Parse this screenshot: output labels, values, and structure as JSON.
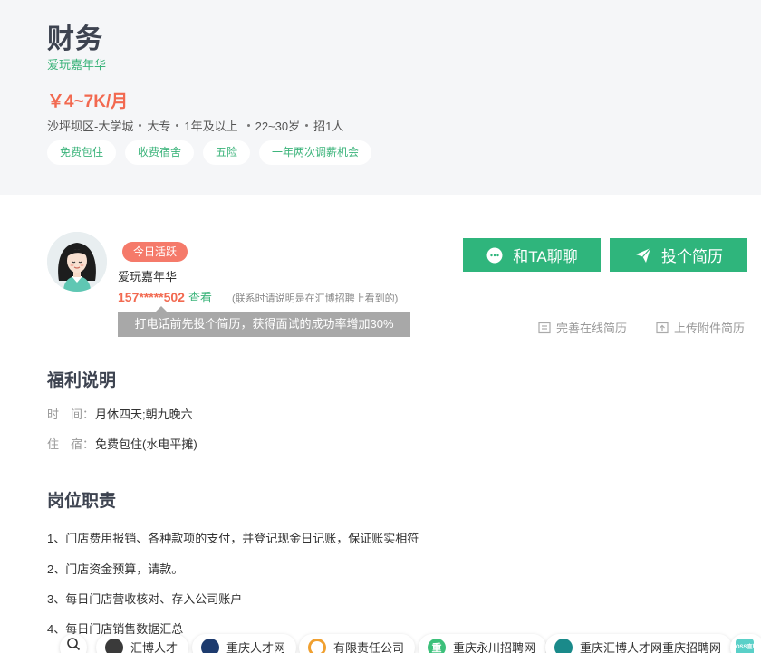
{
  "job": {
    "title": "财务",
    "company": "爱玩嘉年华",
    "salary": "￥4~7K/月",
    "meta": [
      "沙坪坝区-大学城",
      "大专",
      "1年及以上",
      "22~30岁",
      "招1人"
    ],
    "tags": [
      "免费包住",
      "收费宿舍",
      "五险",
      "一年两次调薪机会"
    ]
  },
  "recruiter": {
    "badge": "今日活跃",
    "name": "爱玩嘉年华",
    "phone": "157*****502",
    "view_label": "查看",
    "phone_note": "(联系时请说明是在汇博招聘上看到的)",
    "tooltip": "打电话前先投个简历，获得面试的成功率增加30%"
  },
  "actions": {
    "chat_label": "和TA聊聊",
    "apply_label": "投个简历",
    "online_resume_label": "完善在线简历",
    "upload_resume_label": "上传附件简历"
  },
  "benefits": {
    "title": "福利说明",
    "rows": [
      {
        "label": "时　间：",
        "value": "月休四天;朝九晚六"
      },
      {
        "label": "住　宿：",
        "value": "免费包住(水电平摊)"
      }
    ]
  },
  "duties": {
    "title": "岗位职责",
    "items": [
      "1、门店费用报销、各种款项的支付，并登记现金日记账，保证账实相符",
      "2、门店资金预算，请款。",
      "3、每日门店营收核对、存入公司账户",
      "4、每日门店销售数据汇总"
    ]
  },
  "bottom_bar": {
    "items": [
      {
        "label": "汇博人才",
        "logo": "",
        "color": "#3a3a3a"
      },
      {
        "label": "重庆人才网",
        "logo": "",
        "color": "#1d3b6e"
      },
      {
        "label": "有限责任公司",
        "logo": "",
        "color": "#f0a030"
      },
      {
        "label": "重庆永川招聘网",
        "logo": "重",
        "color": "#3cc07a"
      },
      {
        "label": "重庆汇博人才网重庆招聘网",
        "logo": "",
        "color": "#1a8a8a"
      },
      {
        "label": "",
        "logo": "BOSS直聘",
        "color": "#5ad0c8"
      }
    ]
  },
  "colors": {
    "accent": "#2fb57c",
    "salary": "#f26950",
    "badge": "#f57a6a"
  }
}
